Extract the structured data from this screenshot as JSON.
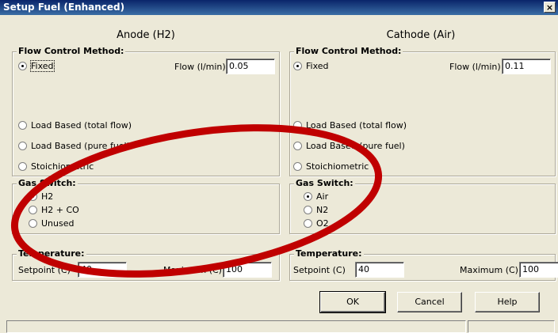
{
  "window": {
    "title": "Setup Fuel (Enhanced)",
    "close_glyph": "×"
  },
  "anode": {
    "heading": "Anode (H2)",
    "flow_control": {
      "legend": "Flow Control Method:",
      "options": [
        "Fixed",
        "Load Based (total flow)",
        "Load Based (pure fuel)",
        "Stoichiometric"
      ],
      "selected": "Fixed",
      "flow_label": "Flow (l/min)",
      "flow_value": "0.05"
    },
    "gas_switch": {
      "legend": "Gas Switch:",
      "options": [
        "H2",
        "H2 + CO",
        "Unused"
      ],
      "selected": "H2"
    },
    "temperature": {
      "legend": "Temperature:",
      "setpoint_label": "Setpoint (C)",
      "setpoint_value": "40",
      "maximum_label": "Maximum (C)",
      "maximum_value": "100"
    }
  },
  "cathode": {
    "heading": "Cathode (Air)",
    "flow_control": {
      "legend": "Flow Control Method:",
      "options": [
        "Fixed",
        "Load Based (total flow)",
        "Load Based (pure fuel)",
        "Stoichiometric"
      ],
      "selected": "Fixed",
      "flow_label": "Flow (l/min)",
      "flow_value": "0.11"
    },
    "gas_switch": {
      "legend": "Gas Switch:",
      "options": [
        "Air",
        "N2",
        "O2"
      ],
      "selected": "Air"
    },
    "temperature": {
      "legend": "Temperature:",
      "setpoint_label": "Setpoint (C)",
      "setpoint_value": "40",
      "maximum_label": "Maximum (C)",
      "maximum_value": "100"
    }
  },
  "buttons": {
    "ok": "OK",
    "cancel": "Cancel",
    "help": "Help"
  },
  "annotation": {
    "color": "#c00000"
  },
  "colors": {
    "dialog_bg": "#ece9d8",
    "title_bar": "#0a246a"
  }
}
